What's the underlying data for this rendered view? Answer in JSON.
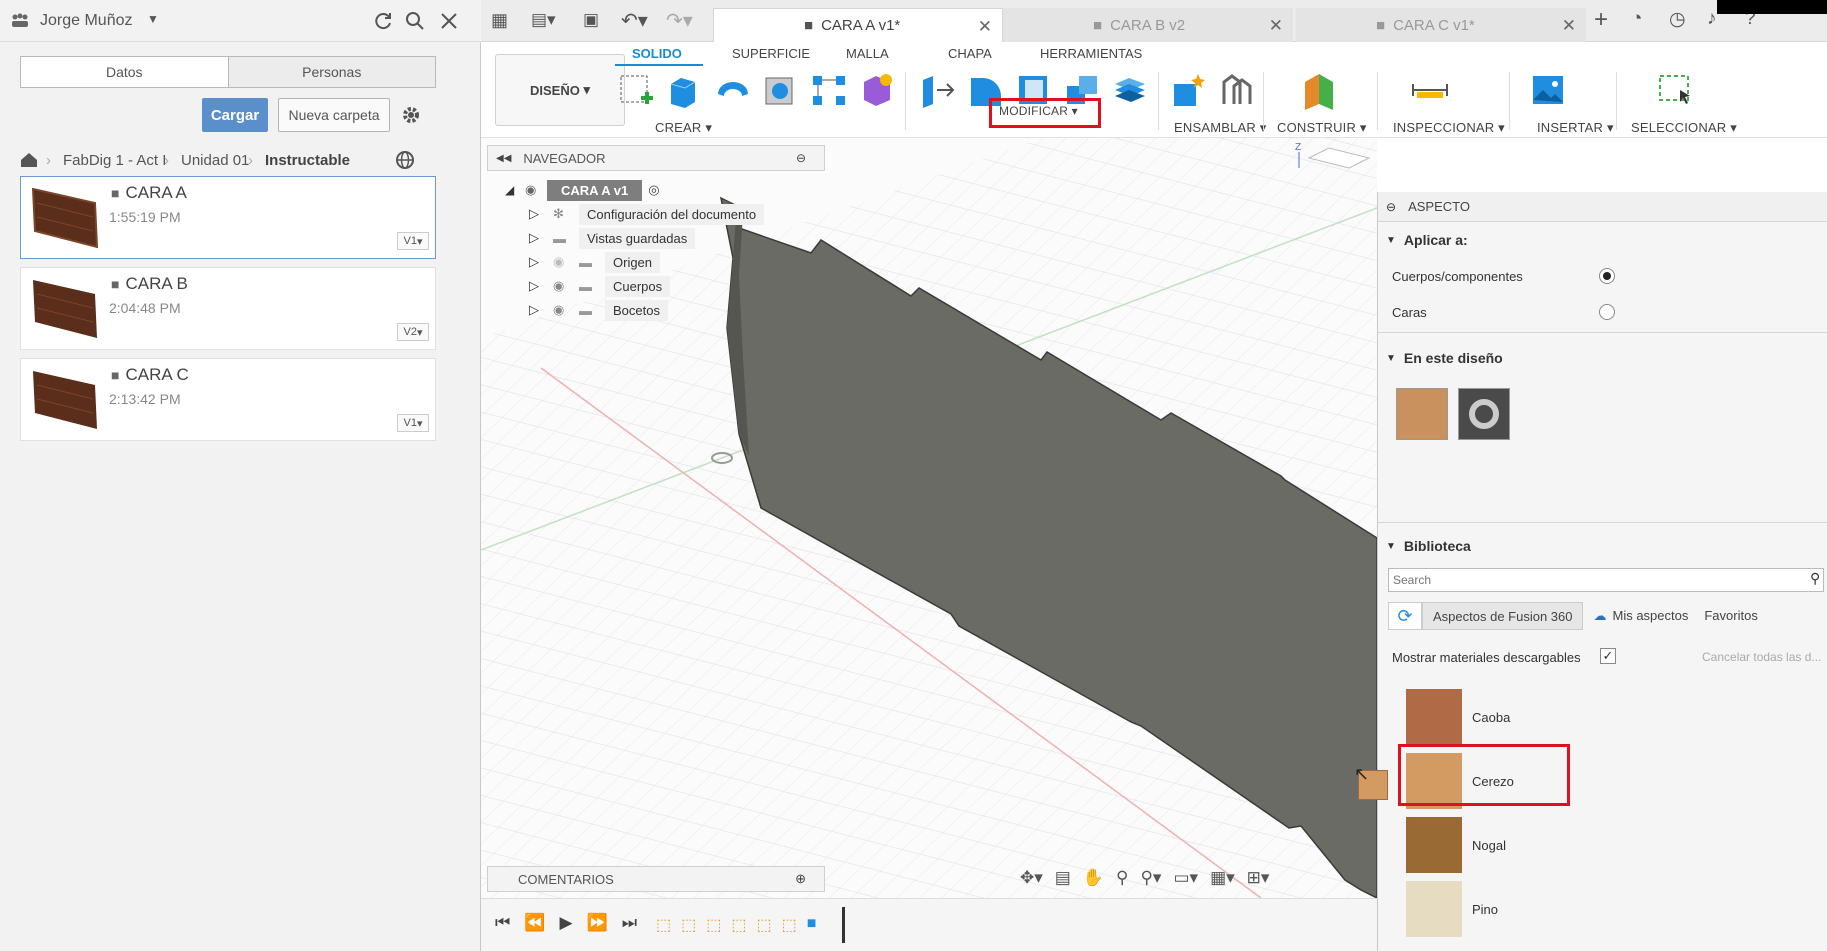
{
  "data_panel": {
    "user": "Jorge Muñoz",
    "tabs": [
      "Datos",
      "Personas"
    ],
    "upload_label": "Cargar",
    "new_folder_label": "Nueva carpeta",
    "breadcrumb": [
      "FabDig 1 - Act I",
      "Unidad 01",
      "Instructable"
    ],
    "files": [
      {
        "name": "CARA A",
        "time": "1:55:19 PM",
        "version": "V1"
      },
      {
        "name": "CARA B",
        "time": "2:04:48 PM",
        "version": "V2"
      },
      {
        "name": "CARA C",
        "time": "2:13:42 PM",
        "version": "V1"
      }
    ]
  },
  "doc_tabs": [
    {
      "label": "CARA A v1*"
    },
    {
      "label": "CARA B v2"
    },
    {
      "label": "CARA C v1*"
    }
  ],
  "toolbar": {
    "workspace": "DISEÑO",
    "tabs": [
      "SOLIDO",
      "SUPERFICIE",
      "MALLA",
      "CHAPA",
      "HERRAMIENTAS"
    ],
    "groups": [
      "CREAR",
      "MODIFICAR",
      "ENSAMBLAR",
      "CONSTRUIR",
      "INSPECCIONAR",
      "INSERTAR",
      "SELECCIONAR"
    ]
  },
  "navigator": {
    "title": "NAVEGADOR",
    "root": "CARA  A v1",
    "items": [
      "Configuración del documento",
      "Vistas guardadas",
      "Origen",
      "Cuerpos",
      "Bocetos"
    ]
  },
  "comments_label": "COMENTARIOS",
  "aspecto": {
    "title": "ASPECTO",
    "apply_to_title": "Aplicar a:",
    "apply_options": [
      "Cuerpos/componentes",
      "Caras"
    ],
    "in_design_title": "En este diseño",
    "library_title": "Biblioteca",
    "search_placeholder": "Search",
    "library_tabs": [
      "Aspectos de Fusion 360",
      "Mis aspectos",
      "Favoritos"
    ],
    "show_downloadable": "Mostrar materiales descargables",
    "cancel_all": "Cancelar todas las d...",
    "materials": [
      {
        "name": "Caoba",
        "color": "#b06a45"
      },
      {
        "name": "Cerezo",
        "color": "#d39a62"
      },
      {
        "name": "Nogal",
        "color": "#9a6a34"
      },
      {
        "name": "Pino",
        "color": "#e6dcc1"
      }
    ]
  },
  "colors": {
    "accent": "#1a8ad4",
    "upload": "#5b8fcc",
    "highlight": "#e0101e",
    "body": "#6b6b66"
  }
}
